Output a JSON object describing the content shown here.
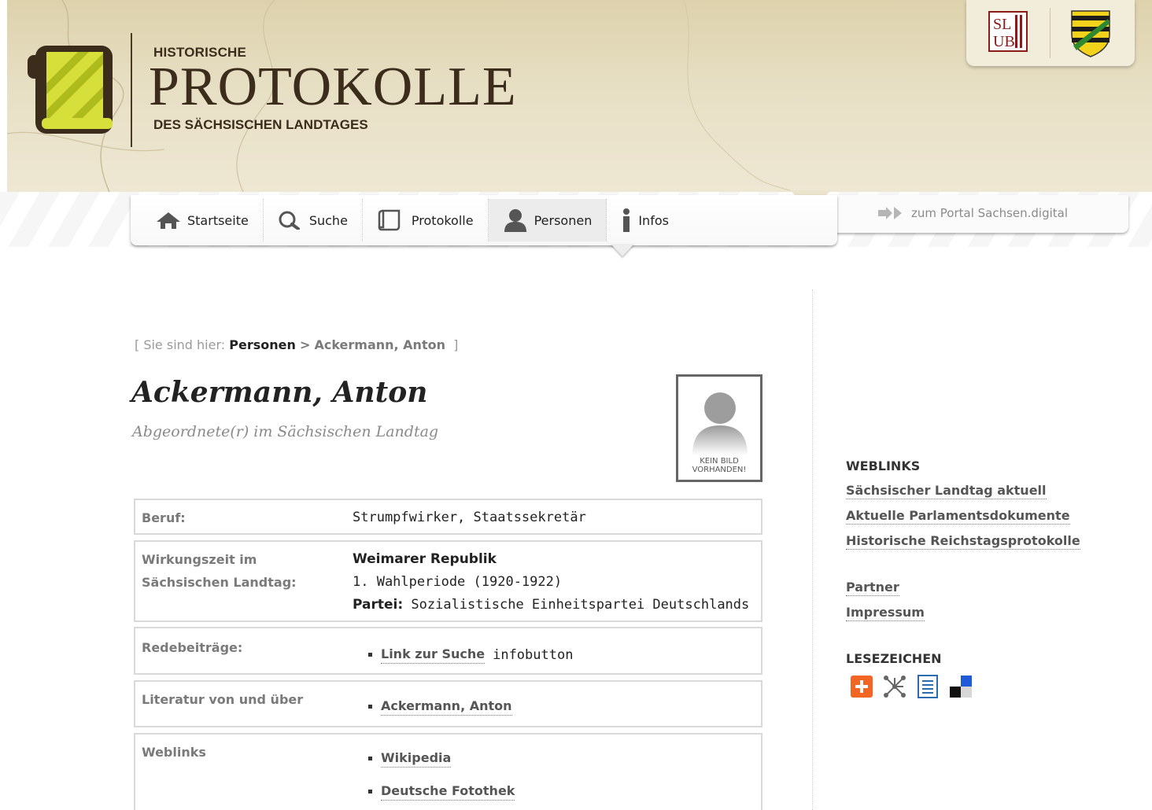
{
  "header": {
    "title_small": "HISTORISCHE",
    "title_big": "PROTOKOLLE",
    "title_sub": "DES SÄCHSISCHEN LANDTAGES",
    "slub_logo_text": "SLUB",
    "logo_icon": "scroll-logo-icon",
    "coat_icon": "saxony-coat-of-arms-icon"
  },
  "nav": {
    "items": [
      {
        "label": "Startseite",
        "icon": "home-icon"
      },
      {
        "label": "Suche",
        "icon": "search-icon"
      },
      {
        "label": "Protokolle",
        "icon": "document-icon"
      },
      {
        "label": "Personen",
        "icon": "person-icon",
        "active": true
      },
      {
        "label": "Infos",
        "icon": "info-icon"
      }
    ],
    "portal_label": "zum Portal Sachsen.digital"
  },
  "breadcrumb": {
    "open": "[ Sie sind hier:",
    "section": "Personen",
    "separator": ">",
    "current": "Ackermann, Anton",
    "close": "]"
  },
  "person": {
    "name": "Ackermann, Anton",
    "role": "Abgeordnete(r)  im Sächsischen Landtag",
    "photo_caption_line1": "KEIN BILD",
    "photo_caption_line2": "VORHANDEN!"
  },
  "details": {
    "beruf_label": "Beruf:",
    "beruf_value": "Strumpfwirker, Staatssekretär",
    "wirkung_label_line1": "Wirkungszeit im",
    "wirkung_label_line2": "Sächsischen Landtag:",
    "wirkung_era": "Weimarer Republik",
    "wirkung_period": "1. Wahlperiode (1920-1922)",
    "wirkung_party_label": "Partei:",
    "wirkung_party": "Sozialistische Einheitspartei Deutschlands",
    "rede_label": "Redebeiträge:",
    "rede_link": "Link zur Suche",
    "rede_extra": "infobutton",
    "literatur_label": "Literatur von und über",
    "literatur_link": "Ackermann, Anton",
    "weblinks_label": "Weblinks",
    "weblinks": [
      "Wikipedia",
      "Deutsche Fotothek"
    ]
  },
  "sidebar": {
    "weblinks_heading": "WEBLINKS",
    "weblinks": [
      "Sächsischer Landtag aktuell",
      "Aktuelle Parlamentsdokumente",
      "Historische Reichstagsprotokolle"
    ],
    "partner": "Partner",
    "impressum": "Impressum",
    "bookmarks_heading": "LESEZEICHEN",
    "bookmark_icons": [
      "add-bookmark-icon",
      "share-network-icon",
      "list-icon",
      "delicious-icon"
    ]
  },
  "colors": {
    "header_bg": "#e3dabd",
    "logo_brown": "#3b2c1c",
    "logo_yellow": "#d7df3a",
    "link_gray": "#555555",
    "border_gray": "#d9d9d9"
  }
}
